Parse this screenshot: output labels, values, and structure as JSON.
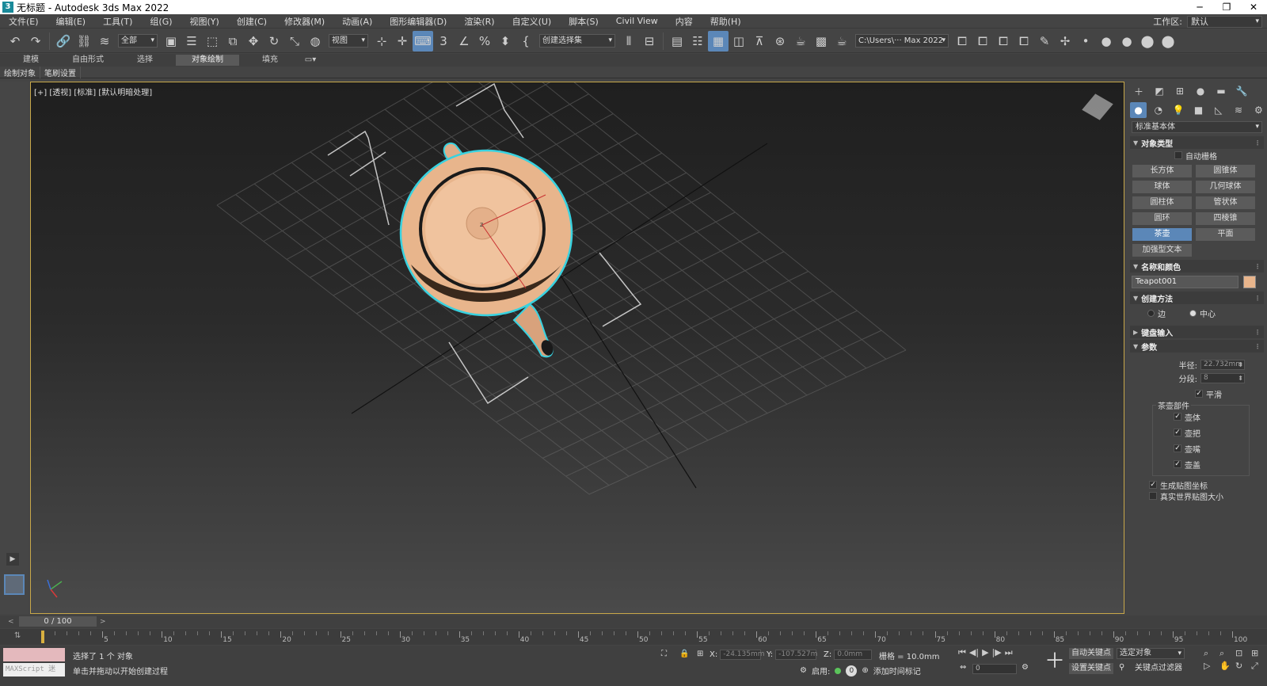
{
  "titlebar": {
    "icon": "3",
    "title": "无标题 - Autodesk 3ds Max 2022",
    "minimize": "─",
    "maximize": "❐",
    "close": "✕"
  },
  "menu": [
    "文件(E)",
    "编辑(E)",
    "工具(T)",
    "组(G)",
    "视图(Y)",
    "创建(C)",
    "修改器(M)",
    "动画(A)",
    "图形编辑器(D)",
    "渲染(R)",
    "自定义(U)",
    "脚本(S)",
    "Civil View",
    "内容",
    "帮助(H)"
  ],
  "workspace": {
    "label": "工作区:",
    "value": "默认"
  },
  "toolbar": {
    "selection_filter": "全部",
    "ref_coord": "视图",
    "named_selection": "创建选择集",
    "path": "C:\\Users\\··· Max 2022"
  },
  "ribbon": {
    "tabs": [
      "建模",
      "自由形式",
      "选择",
      "对象绘制",
      "填充"
    ],
    "active_tab": "对象绘制",
    "subtabs": [
      "绘制对象",
      "笔刷设置"
    ]
  },
  "viewport": {
    "label": "[+] [透视] [标准] [默认明暗处理]",
    "object_color": "#e8b58c",
    "selection_color": "#38d2e0",
    "pivot_label": "z"
  },
  "command_panel": {
    "category": "标准基本体",
    "object_type": {
      "title": "对象类型",
      "auto_grid": "自动栅格",
      "buttons": [
        "长方体",
        "圆锥体",
        "球体",
        "几何球体",
        "圆柱体",
        "管状体",
        "圆环",
        "四棱锥",
        "茶壶",
        "平面",
        "加强型文本"
      ],
      "selected": "茶壶"
    },
    "name_color": {
      "title": "名称和颜色",
      "name": "Teapot001",
      "color": "#e8b58c"
    },
    "creation_method": {
      "title": "创建方法",
      "options": [
        "边",
        "中心"
      ],
      "selected": "中心"
    },
    "keyboard_entry": {
      "title": "键盘输入"
    },
    "parameters": {
      "title": "参数",
      "radius_label": "半径:",
      "radius_value": "22.732mm",
      "segments_label": "分段:",
      "segments_value": "8",
      "smooth_label": "平滑",
      "parts_title": "茶壶部件",
      "parts": [
        "壶体",
        "壶把",
        "壶嘴",
        "壶盖"
      ],
      "gen_map": "生成贴图坐标",
      "real_world": "真实世界贴图大小"
    }
  },
  "timeline": {
    "frame": "0 / 100",
    "ticks": [
      "0",
      "5",
      "10",
      "15",
      "20",
      "25",
      "30",
      "35",
      "40",
      "45",
      "50",
      "55",
      "60",
      "65",
      "70",
      "75",
      "80",
      "85",
      "90",
      "95",
      "100"
    ],
    "prev_arrow": "<",
    "next_arrow": ">"
  },
  "status": {
    "maxscript": "MAXScript 迷",
    "selected": "选择了 1 个 对象",
    "hint": "单击并拖动以开始创建过程",
    "x_label": "X:",
    "x_value": "-24.135mm",
    "y_label": "Y:",
    "y_value": "-107.527m",
    "z_label": "Z:",
    "z_value": "0.0mm",
    "grid": "栅格 = 10.0mm",
    "enable_label": "启用:",
    "enable_value": "0",
    "add_time_tag": "添加时间标记",
    "auto_key": "自动关键点",
    "set_key": "设置关键点",
    "selected_object": "选定对象",
    "key_filters": "关键点过滤器",
    "current_frame": "0"
  }
}
